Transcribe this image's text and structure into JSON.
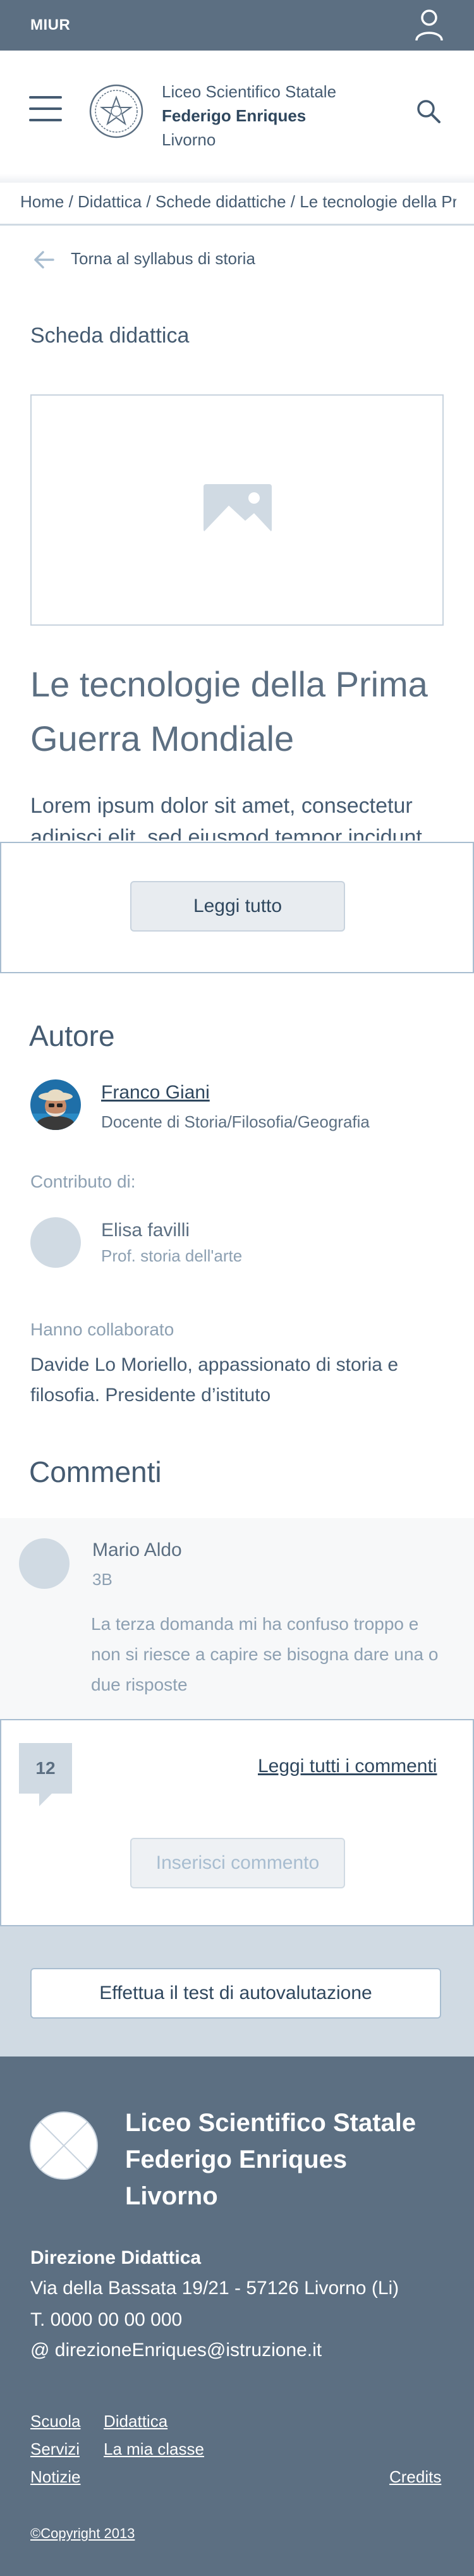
{
  "topbar": {
    "brand": "MIUR",
    "icon": "user-icon"
  },
  "header": {
    "school_line1": "Liceo Scientifico Statale",
    "school_line2": "Federigo Enriques",
    "school_line3": "Livorno",
    "icons": [
      "hamburger-icon",
      "emblem-icon",
      "search-icon"
    ]
  },
  "breadcrumb": "Home / Didattica / Schede didattiche / Le tecnologie della Prima Guerra Mondiale",
  "back_link": "Torna al syllabus di storia",
  "section_label": "Scheda didattica",
  "article": {
    "image_icon": "image-placeholder-icon",
    "title": "Le tecnologie della Prima Guerra Mondiale",
    "lead": "Lorem ipsum dolor sit amet, consectetur adipisci elit, sed eiusmod tempor incidunt",
    "read_more": "Leggi tutto"
  },
  "author": {
    "heading": "Autore",
    "name": "Franco Giani",
    "role": "Docente di Storia/Filosofia/Geografia",
    "contrib_label": "Contributo di:",
    "contrib_name": "Elisa favilli",
    "contrib_role": "Prof. storia dell'arte",
    "collab_label": "Hanno collaborato",
    "collab_text": "Davide Lo Moriello, appassionato di storia e filosofia. Presidente d’istituto"
  },
  "comments": {
    "heading": "Commenti",
    "items": [
      {
        "name": "Mario Aldo",
        "class": "3B",
        "text": "La terza domanda mi ha confuso troppo e non si riesce a capire se bisogna dare una o due risposte"
      }
    ],
    "count": "12",
    "read_all": "Leggi tutti i commenti",
    "insert": "Inserisci commento"
  },
  "test_button": "Effettua il test di autovalutazione",
  "footer": {
    "school_line1": "Liceo Scientifico Statale",
    "school_line2": "Federigo Enriques",
    "school_line3": "Livorno",
    "direction_title": "Direzione Didattica",
    "address": "Via della Bassata 19/21 - 57126 Livorno (Li)",
    "phone": "T. 0000 00 00 000",
    "email": "@ direzioneEnriques@istruzione.it",
    "links": {
      "scuola": "Scuola",
      "didattica": "Didattica",
      "servizi": "Servizi",
      "classe": "La mia classe",
      "notizie": "Notizie",
      "credits": "Credits"
    },
    "copyright": "©Copyright 2013"
  }
}
